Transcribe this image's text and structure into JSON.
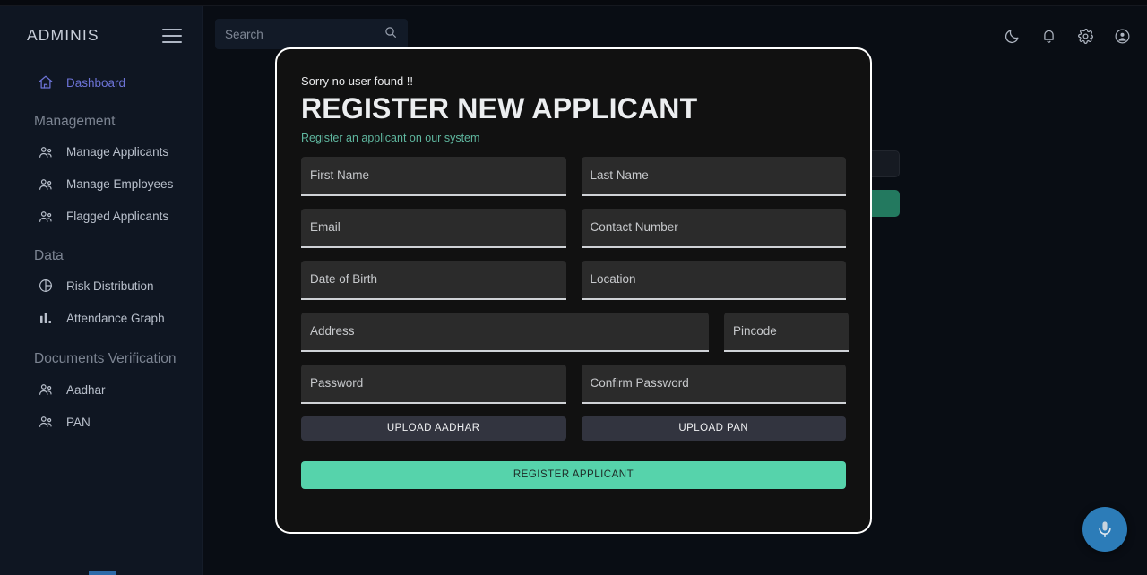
{
  "app": {
    "brand": "ADMINIS",
    "menu_icon": "hamburger-icon"
  },
  "sidebar": {
    "items": [
      {
        "label": "Dashboard",
        "icon": "home-icon",
        "active": true,
        "type": "item"
      },
      {
        "label": "Management",
        "type": "section"
      },
      {
        "label": "Manage Applicants",
        "icon": "users-icon",
        "type": "item"
      },
      {
        "label": "Manage Employees",
        "icon": "users-icon",
        "type": "item"
      },
      {
        "label": "Flagged Applicants",
        "icon": "users-icon",
        "type": "item"
      },
      {
        "label": "Data",
        "type": "section"
      },
      {
        "label": "Risk Distribution",
        "icon": "pie-chart-icon",
        "type": "item"
      },
      {
        "label": "Attendance Graph",
        "icon": "bar-chart-icon",
        "type": "item"
      },
      {
        "label": "Documents Verification",
        "type": "section"
      },
      {
        "label": "Aadhar",
        "icon": "users-icon",
        "type": "item"
      },
      {
        "label": "PAN",
        "icon": "users-icon",
        "type": "item"
      }
    ]
  },
  "topbar": {
    "search": {
      "placeholder": "Search",
      "value": "",
      "icon": "search-icon"
    },
    "icons": [
      {
        "name": "moon-icon",
        "label": "Dark mode"
      },
      {
        "name": "bell-icon",
        "label": "Notifications"
      },
      {
        "name": "gear-icon",
        "label": "Settings"
      },
      {
        "name": "avatar-icon",
        "label": "Account"
      }
    ]
  },
  "modal": {
    "message": "Sorry no user found !!",
    "title": "REGISTER NEW APPLICANT",
    "subtitle": "Register an applicant on our system",
    "fields": [
      {
        "label": "First Name",
        "value": "",
        "size": "half"
      },
      {
        "label": "Last Name",
        "value": "",
        "size": "half"
      },
      {
        "label": "Email",
        "value": "",
        "size": "half"
      },
      {
        "label": "Contact Number",
        "value": "",
        "size": "half"
      },
      {
        "label": "Date of Birth",
        "value": "",
        "size": "half"
      },
      {
        "label": "Location",
        "value": "",
        "size": "half"
      },
      {
        "label": "Address",
        "value": "",
        "size": "wide"
      },
      {
        "label": "Pincode",
        "value": "",
        "size": "narrow"
      },
      {
        "label": "Password",
        "value": "",
        "size": "half"
      },
      {
        "label": "Confirm Password",
        "value": "",
        "size": "half"
      }
    ],
    "upload_aadhar_label": "UPLOAD AADHAR",
    "upload_pan_label": "UPLOAD PAN",
    "submit_label": "REGISTER APPLICANT"
  },
  "fab": {
    "icon": "microphone-icon",
    "color": "#2c7cb8"
  },
  "colors": {
    "accent_green": "#56d3ab",
    "accent_teal_text": "#5fb79f",
    "active_nav": "#6c73d6",
    "sidebar_bg": "#0f1622",
    "page_bg": "#090d14",
    "modal_bg": "#111111"
  }
}
